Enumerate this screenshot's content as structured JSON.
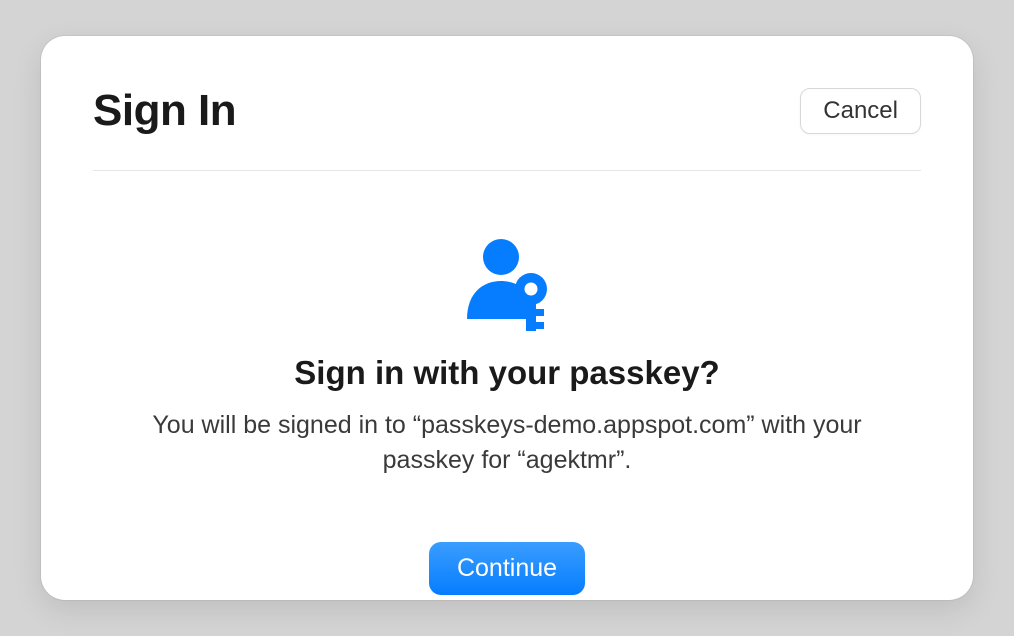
{
  "header": {
    "title": "Sign In",
    "cancel_label": "Cancel"
  },
  "prompt": {
    "heading": "Sign in with your passkey?",
    "description": "You will be signed in to “passkeys-demo.appspot.com” with your passkey for “agektmr”."
  },
  "actions": {
    "continue_label": "Continue"
  },
  "colors": {
    "accent": "#067dff"
  },
  "icon": "passkey-person-key-icon"
}
